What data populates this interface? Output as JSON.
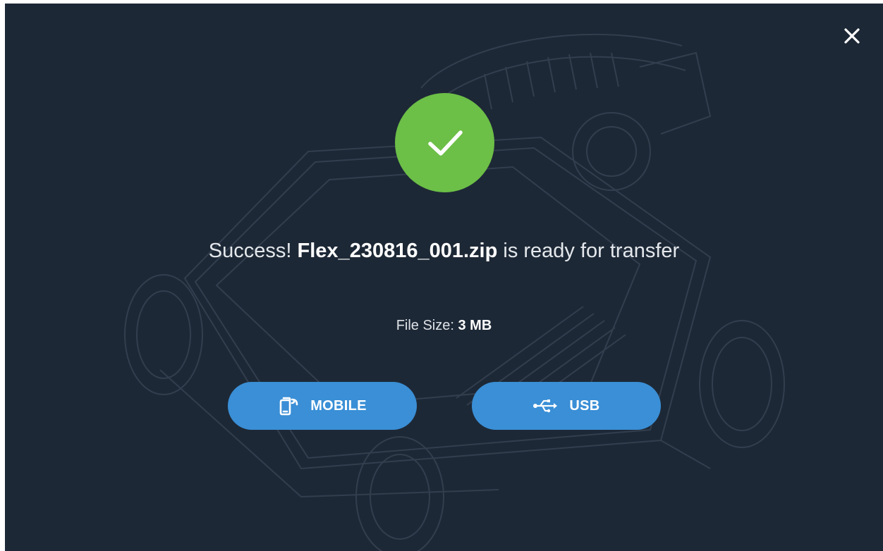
{
  "dialog": {
    "message_prefix": "Success!",
    "file_name": "Flex_230816_001.zip",
    "message_suffix": "is ready for transfer",
    "file_size_label": "File Size:",
    "file_size_value": "3 MB"
  },
  "actions": {
    "mobile_label": "MOBILE",
    "usb_label": "USB"
  },
  "icons": {
    "close": "close-icon",
    "success": "checkmark-icon",
    "mobile": "mobile-wireless-icon",
    "usb": "usb-icon"
  },
  "colors": {
    "background": "#1d2836",
    "success": "#6cbf47",
    "button": "#3a8fd6",
    "text": "#e4e8ec"
  }
}
